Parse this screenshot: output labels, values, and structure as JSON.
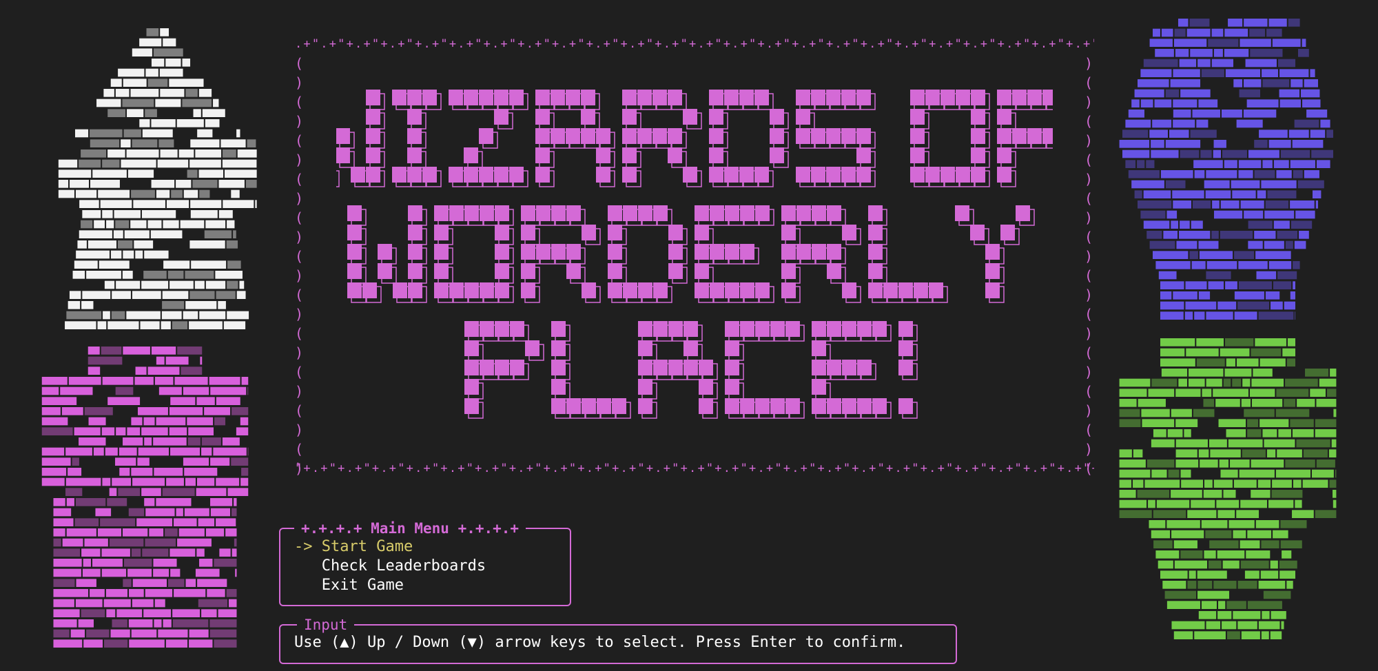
{
  "game": {
    "title_lines": [
      "WIZARDS OF",
      "WORDERLY",
      "PLACE!"
    ],
    "title_color": "#d46ad6",
    "background_color": "#1f1f1f",
    "frame": {
      "top_edge": ".+\".+\"+.+\"+.+\"+.+\"+.+\"+.+\"+.+\"+.+\"+.+\"+.+\"+.+\"+.+\"+.+\"+.+\"+.+\"+.+\"+.+\"+.+\"+.+\"+.+\"+.+\"+.+\"+.+\"+.+\"+.+\"+.+\"+.",
      "bottom_edge": "\"+.+\"+.+\"+.+\"+.+\"+.+\"+.+\"+.+\"+.+\"+.+\"+.+\"+.+\"+.+\"+.+\"+.+\"+.+\"+.+\"+.+\"+.+\"+.+\"+.+\"+.+\"+.+\"+.+\"+.+\"+.+\"+.+\"+.+\"",
      "left_chars": [
        "(",
        ")",
        "(",
        ")",
        "(",
        ")",
        "(",
        ")",
        "(",
        ")",
        "(",
        ")",
        "(",
        ")",
        "(",
        ")",
        "(",
        ")",
        "(",
        ")",
        "(",
        ")"
      ],
      "right_chars": [
        ")",
        "(",
        ")",
        "(",
        ")",
        "(",
        ")",
        "(",
        ")",
        "(",
        ")",
        "(",
        ")",
        "(",
        ")",
        "(",
        ")",
        "(",
        ")",
        "(",
        ")",
        "("
      ]
    },
    "sprites": [
      {
        "name": "white-wizard-sprite",
        "color": "#f2f2f2"
      },
      {
        "name": "blue-wizard-sprite",
        "color": "#6654e6"
      },
      {
        "name": "pink-wizard-sprite",
        "color": "#d860dc"
      },
      {
        "name": "green-wizard-sprite",
        "color": "#72cc48"
      }
    ]
  },
  "menu": {
    "title": "+.+.+.+ Main Menu +.+.+.+",
    "items": [
      {
        "label": "-> Start Game",
        "selected": true
      },
      {
        "label": "   Check Leaderboards",
        "selected": false
      },
      {
        "label": "   Exit Game",
        "selected": false
      }
    ],
    "selected_color": "#d8cc6a"
  },
  "input": {
    "title": "Input",
    "instruction": "Use (▲) Up / Down (▼) arrow keys to select. Press Enter to confirm."
  }
}
